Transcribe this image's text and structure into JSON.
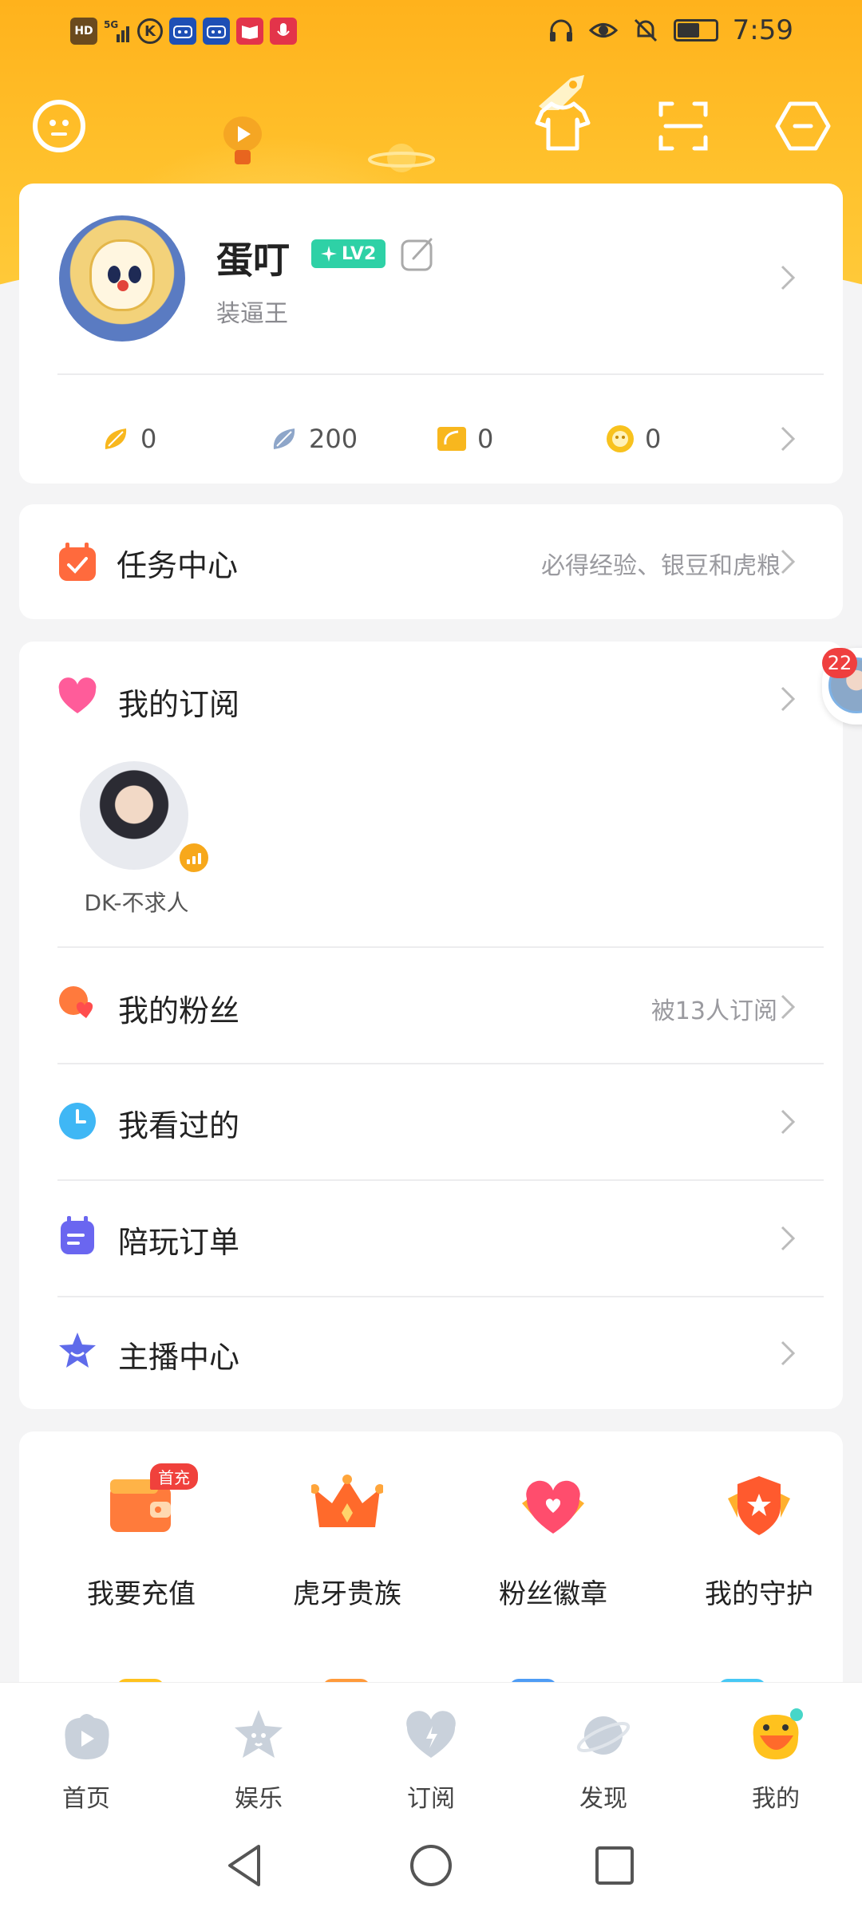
{
  "status_bar": {
    "left_icons": [
      "HD",
      "5G",
      "K",
      "app",
      "app",
      "book",
      "mic"
    ],
    "time": "7:59",
    "battery_level": 0.6
  },
  "top_actions": {
    "icons": [
      "chat-icon",
      "tshirt-icon",
      "scan-icon",
      "settings-hexagon-icon"
    ]
  },
  "profile": {
    "name": "蛋叮",
    "level": "LV2",
    "signature": "装逼王",
    "stats": [
      {
        "icon": "gold-bean-icon",
        "value": "0"
      },
      {
        "icon": "silver-bean-icon",
        "value": "200"
      },
      {
        "icon": "ticket-icon",
        "value": "0"
      },
      {
        "icon": "coin-icon",
        "value": "0"
      }
    ]
  },
  "task_center": {
    "title": "任务中心",
    "subtitle": "必得经验、银豆和虎粮"
  },
  "subscriptions": {
    "title": "我的订阅",
    "streamer_name": "DK-不求人",
    "floating_count": "22"
  },
  "menu_rows": [
    {
      "title": "我的粉丝",
      "subtitle": "被13人订阅",
      "icon": "fans-icon",
      "color": "#ff7a3d"
    },
    {
      "title": "我看过的",
      "subtitle": "",
      "icon": "clock-icon",
      "color": "#3fb7f5"
    },
    {
      "title": "陪玩订单",
      "subtitle": "",
      "icon": "order-icon",
      "color": "#6a66f0"
    },
    {
      "title": "主播中心",
      "subtitle": "",
      "icon": "star-icon",
      "color": "#5f6bea"
    }
  ],
  "grid": [
    {
      "label": "我要充值",
      "icon": "wallet-icon",
      "tag": "首充"
    },
    {
      "label": "虎牙贵族",
      "icon": "crown-icon",
      "tag": ""
    },
    {
      "label": "粉丝徽章",
      "icon": "heart-badge-icon",
      "tag": ""
    },
    {
      "label": "我的守护",
      "icon": "shield-icon",
      "tag": ""
    }
  ],
  "tabs": [
    {
      "label": "首页",
      "icon": "home-icon"
    },
    {
      "label": "娱乐",
      "icon": "entertainment-icon"
    },
    {
      "label": "订阅",
      "icon": "subscribe-icon"
    },
    {
      "label": "发现",
      "icon": "discover-icon"
    },
    {
      "label": "我的",
      "icon": "mine-icon"
    }
  ],
  "colors": {
    "header": "#ffb21c",
    "accent_green": "#2ed1a6",
    "badge_red": "#f0413c"
  }
}
